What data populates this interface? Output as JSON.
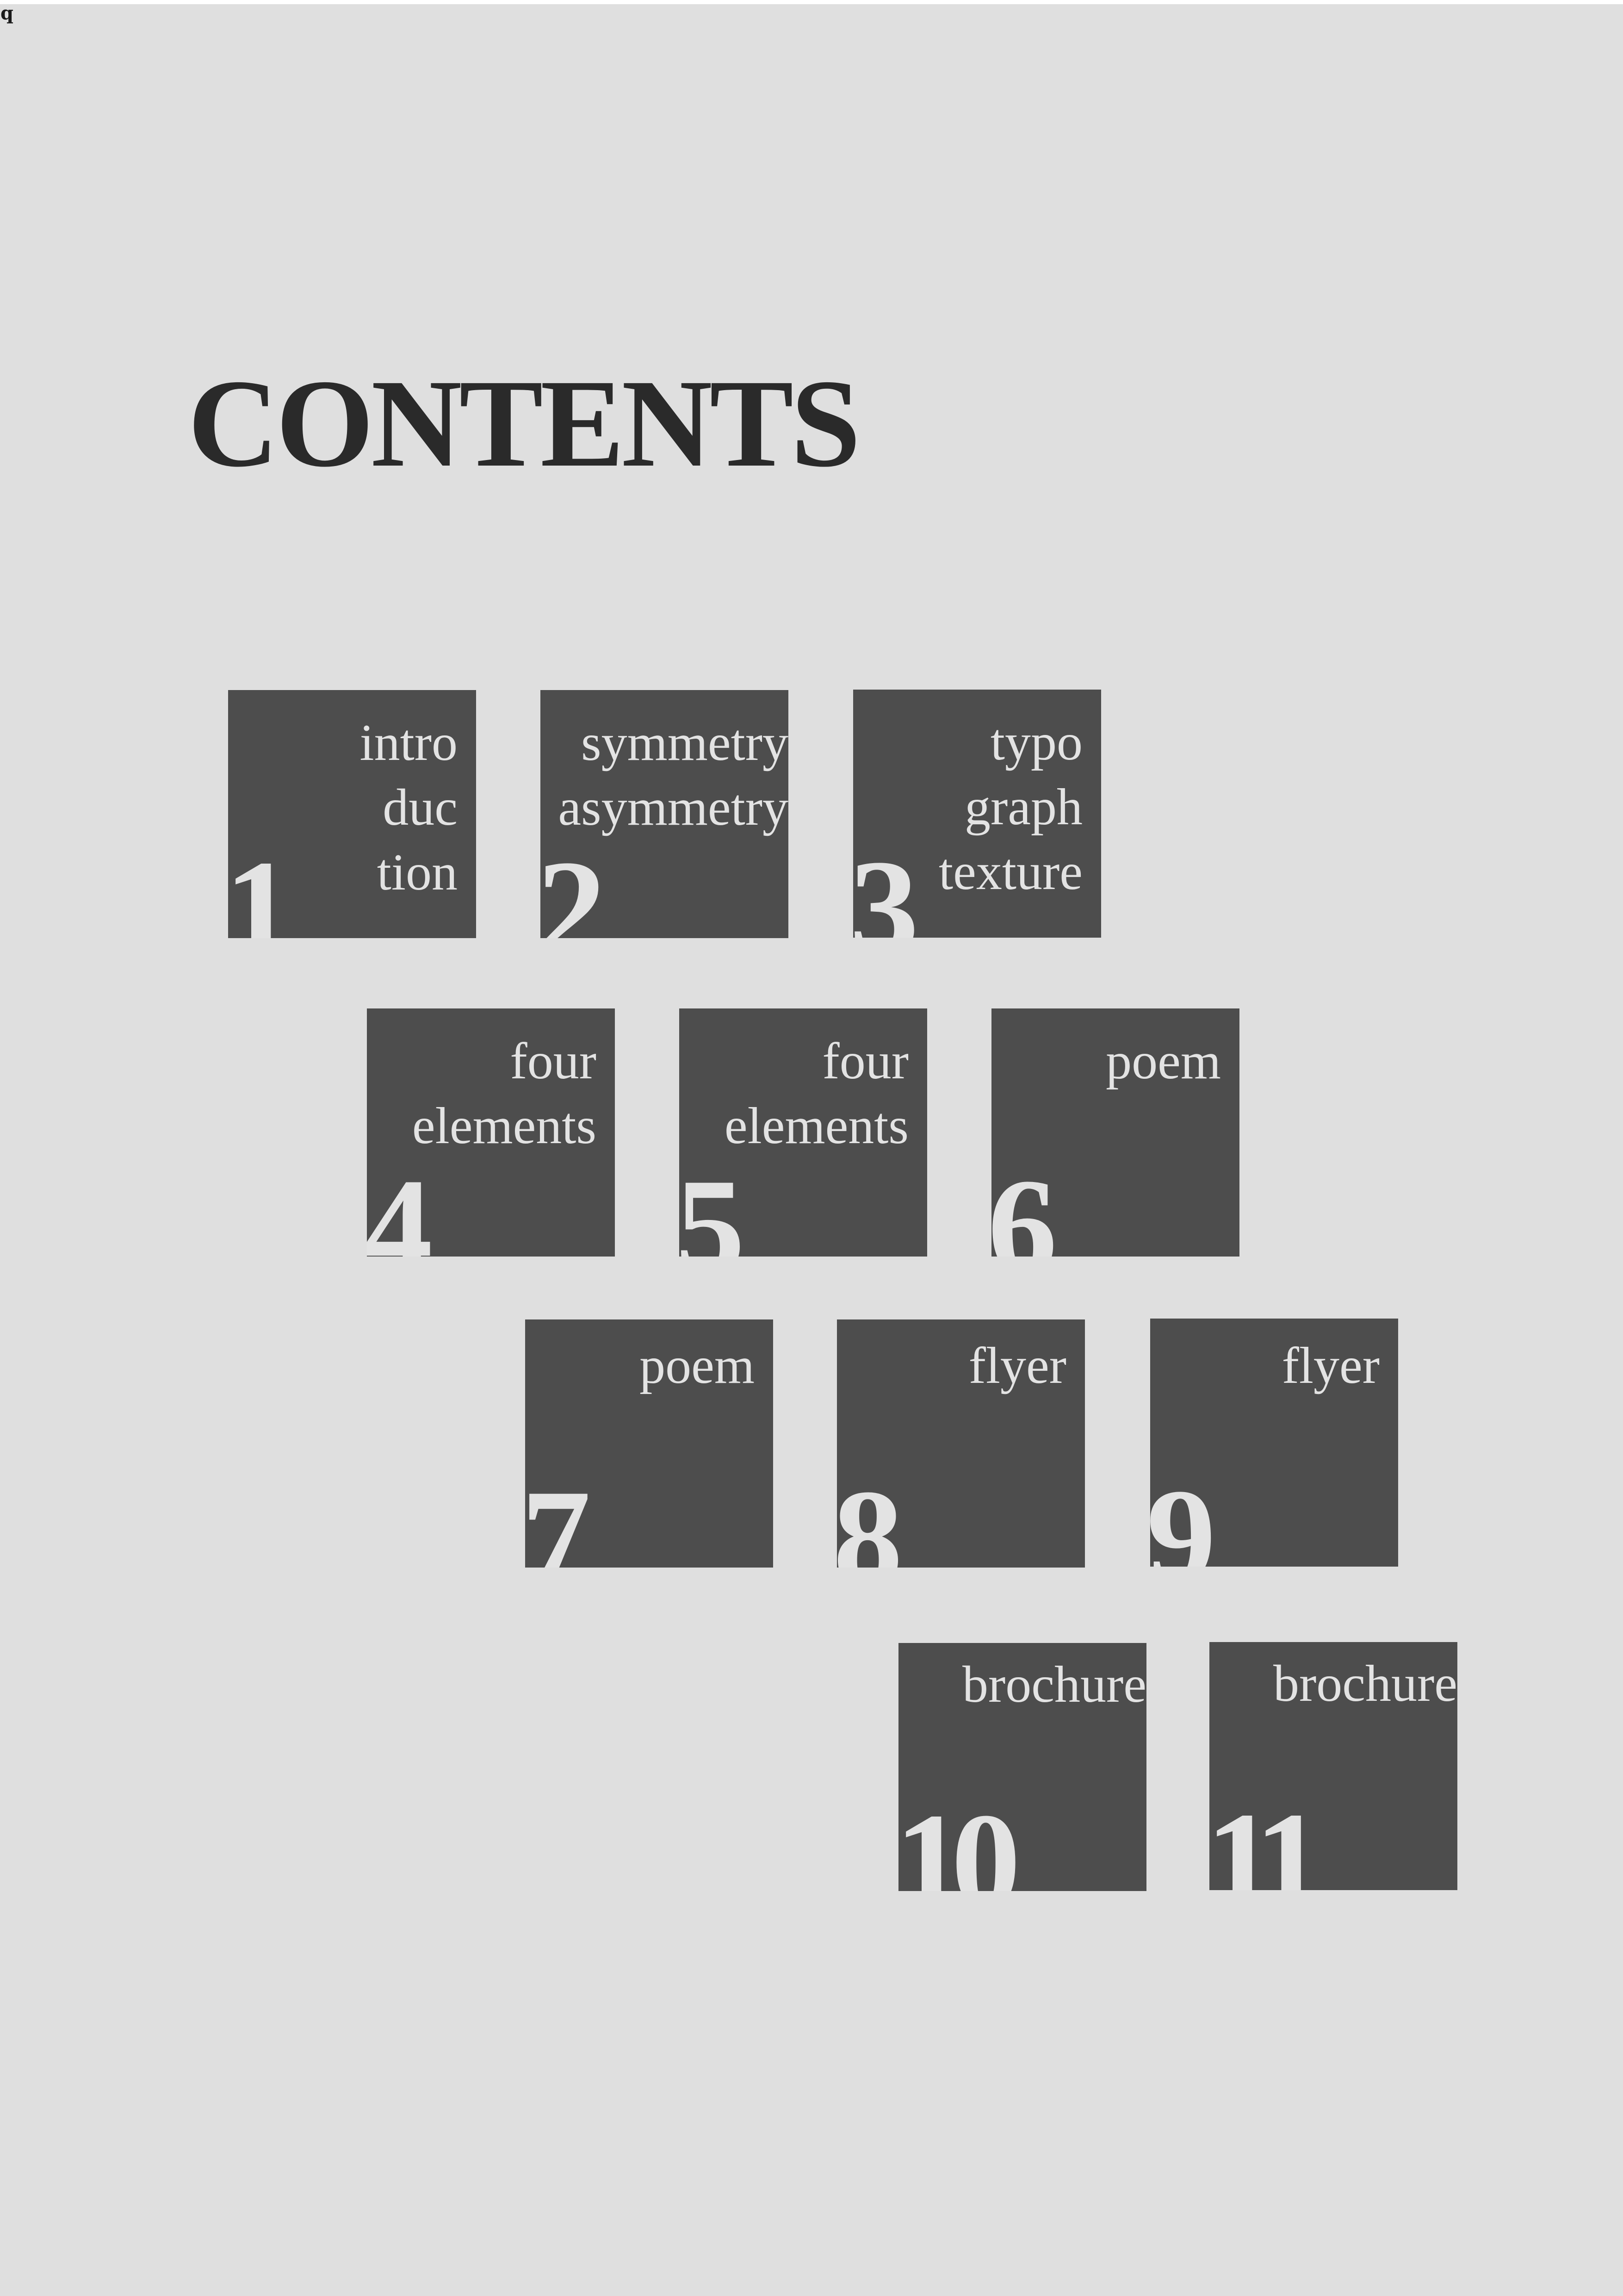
{
  "colors": {
    "background": "#dfdfdf",
    "tile": "#4d4d4d",
    "tile_text": "#e3e3e3",
    "title": "#2a2a2a"
  },
  "corner_mark": "q",
  "title": "CONTENTS",
  "entries": [
    {
      "number": "1",
      "lines": [
        "intro",
        "duc",
        "tion"
      ]
    },
    {
      "number": "2",
      "lines": [
        "symmetry",
        "asymmetry"
      ]
    },
    {
      "number": "3",
      "lines": [
        "typo",
        "graph",
        "texture"
      ]
    },
    {
      "number": "4",
      "lines": [
        "four",
        "elements"
      ]
    },
    {
      "number": "5",
      "lines": [
        "four",
        "elements"
      ]
    },
    {
      "number": "6",
      "lines": [
        "poem"
      ]
    },
    {
      "number": "7",
      "lines": [
        "poem"
      ]
    },
    {
      "number": "8",
      "lines": [
        "flyer"
      ]
    },
    {
      "number": "9",
      "lines": [
        "flyer"
      ]
    },
    {
      "number": "10",
      "lines": [
        "brochure"
      ]
    },
    {
      "number": "11",
      "lines": [
        "brochure"
      ]
    }
  ]
}
